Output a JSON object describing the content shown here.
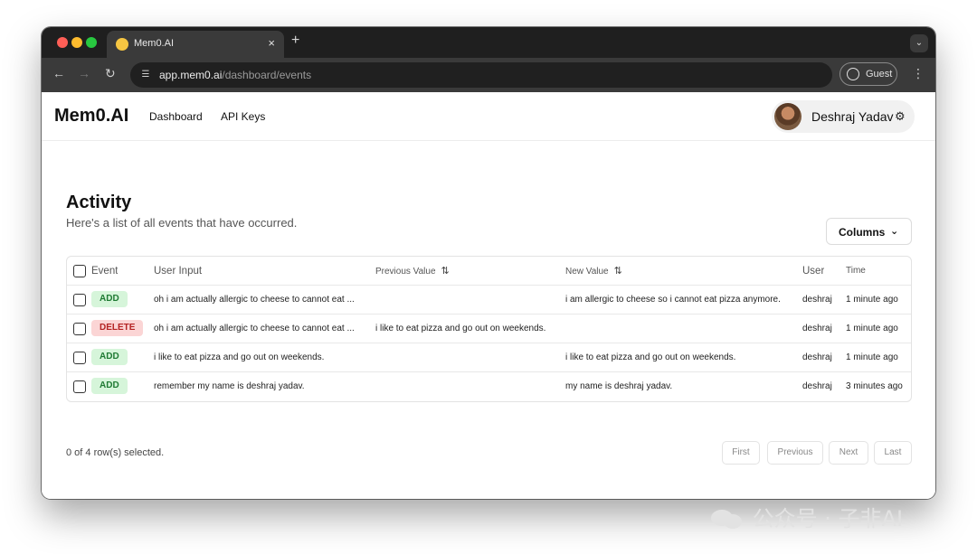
{
  "browser": {
    "tab_title": "Mem0.AI",
    "tab_close": "×",
    "new_tab": "+",
    "url_host": "app.mem0.ai",
    "url_path": "/dashboard/events",
    "guest_label": "Guest"
  },
  "header": {
    "logo": "Mem0.AI",
    "nav": [
      "Dashboard",
      "API Keys"
    ],
    "user_name": "Deshraj Yadav"
  },
  "page": {
    "title": "Activity",
    "subtitle": "Here's a list of all events that have occurred.",
    "columns_button": "Columns"
  },
  "table": {
    "headers": {
      "event": "Event",
      "user_input": "User Input",
      "previous_value": "Previous Value",
      "new_value": "New Value",
      "user": "User",
      "time": "Time"
    },
    "rows": [
      {
        "event": "ADD",
        "user_input": "oh i am actually allergic to cheese to cannot eat ...",
        "previous_value": "",
        "new_value": "i am allergic to cheese so i cannot eat pizza anymore.",
        "user": "deshraj",
        "time": "1 minute ago"
      },
      {
        "event": "DELETE",
        "user_input": "oh i am actually allergic to cheese to cannot eat ...",
        "previous_value": "i like to eat pizza and go out on weekends.",
        "new_value": "",
        "user": "deshraj",
        "time": "1 minute ago"
      },
      {
        "event": "ADD",
        "user_input": "i like to eat pizza and go out on weekends.",
        "previous_value": "",
        "new_value": "i like to eat pizza and go out on weekends.",
        "user": "deshraj",
        "time": "1 minute ago"
      },
      {
        "event": "ADD",
        "user_input": "remember my name is deshraj yadav.",
        "previous_value": "",
        "new_value": "my name is deshraj yadav.",
        "user": "deshraj",
        "time": "3 minutes ago"
      }
    ]
  },
  "footer": {
    "selection": "0 of 4 row(s) selected.",
    "first": "First",
    "previous": "Previous",
    "next": "Next",
    "last": "Last"
  },
  "watermark": "公众号 · 子非AI"
}
